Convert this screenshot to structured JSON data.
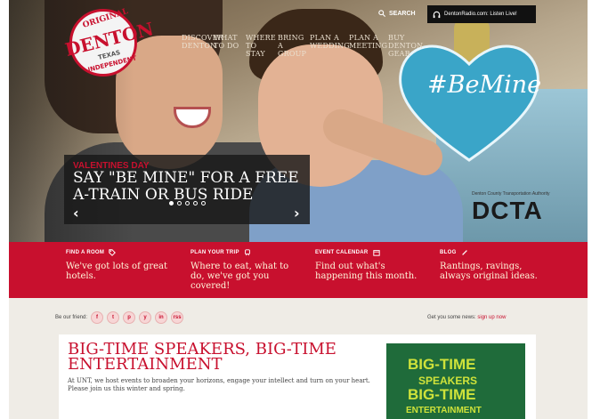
{
  "logo": {
    "top": "ORIGINAL",
    "main": "DENTON",
    "texas": "TEXAS",
    "bottom": "INDEPENDENT"
  },
  "nav": {
    "items": [
      "DISCOVER DENTON",
      "WHAT TO DO",
      "WHERE TO STAY",
      "BRING A GROUP",
      "PLAN A WEDDING",
      "PLAN A MEETING",
      "BUY DENTON GEAR"
    ]
  },
  "search": {
    "label": "SEARCH"
  },
  "radio": {
    "label": "DentonRadio.com: Listen Live!"
  },
  "hero": {
    "heart_text": "#BeMine",
    "dcta_sub": "Denton County Transportation Authority",
    "dcta_main": "DCTA",
    "caption_kicker": "VALENTINES DAY",
    "caption_title": "SAY \"BE MINE\" FOR A FREE A-TRAIN OR BUS RIDE",
    "prev": "‹",
    "next": "›",
    "slides": 5,
    "active_slide": 1
  },
  "band": [
    {
      "heading": "FIND A ROOM",
      "text": "We've got lots of great hotels.",
      "icon": "tag-icon"
    },
    {
      "heading": "PLAN YOUR TRIP",
      "text": "Where to eat, what to do, we've got you covered!",
      "icon": "train-icon"
    },
    {
      "heading": "EVENT CALENDAR",
      "text": "Find out what's happening this month.",
      "icon": "calendar-icon"
    },
    {
      "heading": "BLOG",
      "text": "Rantings, ravings, always original ideas.",
      "icon": "pencil-icon"
    }
  ],
  "social": {
    "label": "Be our friend:",
    "icons": [
      "f",
      "t",
      "p",
      "y",
      "in",
      "rss"
    ]
  },
  "news": {
    "label": "Get you some news:",
    "link": "sign up now"
  },
  "article": {
    "title": "BIG-TIME SPEAKERS, BIG-TIME ENTERTAINMENT",
    "body": "At UNT, we host events to broaden your horizons, engage your intellect and turn on your heart. Please join us this winter and spring."
  },
  "promo": {
    "line1": "BIG-TIME",
    "line2": "SPEAKERS",
    "line3": "BIG-TIME",
    "line4": "ENTERTAINMENT"
  },
  "colors": {
    "brand_red": "#c8102e",
    "promo_green": "#1f6b3a",
    "promo_text": "#cfe23a",
    "heart_blue": "#3aa5c8"
  }
}
